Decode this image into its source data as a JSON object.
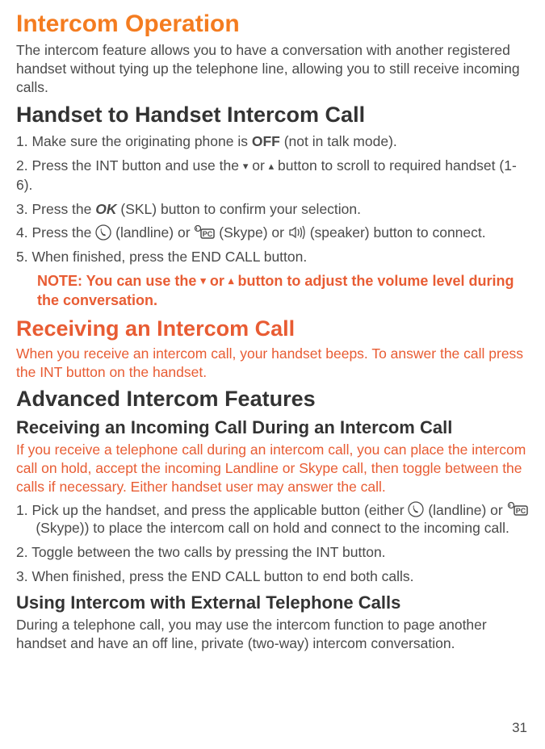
{
  "title": "Intercom Operation",
  "intro": "The intercom feature allows you to have a conversation with another registered handset without tying up the telephone line, allowing you to still receive incoming calls.",
  "section1": {
    "heading": "Handset to Handset Intercom Call",
    "step1a": "1. Make sure the originating phone is ",
    "step1b": "OFF",
    "step1c": " (not in talk mode).",
    "step2a": "2. Press the INT button and use the ",
    "step2b": " or ",
    "step2c": " button to scroll to required handset (1-6).",
    "step3a": "3. Press the ",
    "step3b": "OK",
    "step3c": " (SKL) button to confirm your selection.",
    "step4a": "4. Press the ",
    "step4b": " (landline) or ",
    "step4c": " (Skype) or ",
    "step4d": " (speaker) button to connect.",
    "step5": "5. When finished, press the END CALL button.",
    "note_a": "NOTE: You can use the ",
    "note_b": " or ",
    "note_c": " button to adjust the volume level during the conversation."
  },
  "section2": {
    "heading": "Receiving an Intercom Call",
    "text": "When you receive an intercom call, your handset beeps. To answer the call press the INT button on the handset."
  },
  "section3": {
    "heading": "Advanced Intercom Features",
    "sub1": {
      "heading": "Receiving an Incoming Call During an Intercom Call",
      "intro": "If you receive a telephone call during an intercom call, you can place the intercom call on hold, accept the incoming Landline or Skype call, then toggle between the calls if necessary. Either handset user may answer the call.",
      "step1a": "1. Pick up the handset, and press the applicable button (either ",
      "step1b": " (landline) or ",
      "step1c": " (Skype)) to place the intercom call on hold and connect to the incoming call.",
      "step2": "2. Toggle between the two calls by pressing the INT button.",
      "step3": "3. When finished, press the END CALL button to end both calls."
    },
    "sub2": {
      "heading": "Using Intercom with External Telephone Calls",
      "text": "During a telephone call, you may use the intercom function to page another handset and have an off line, private (two-way) intercom conversation."
    }
  },
  "page": "31"
}
